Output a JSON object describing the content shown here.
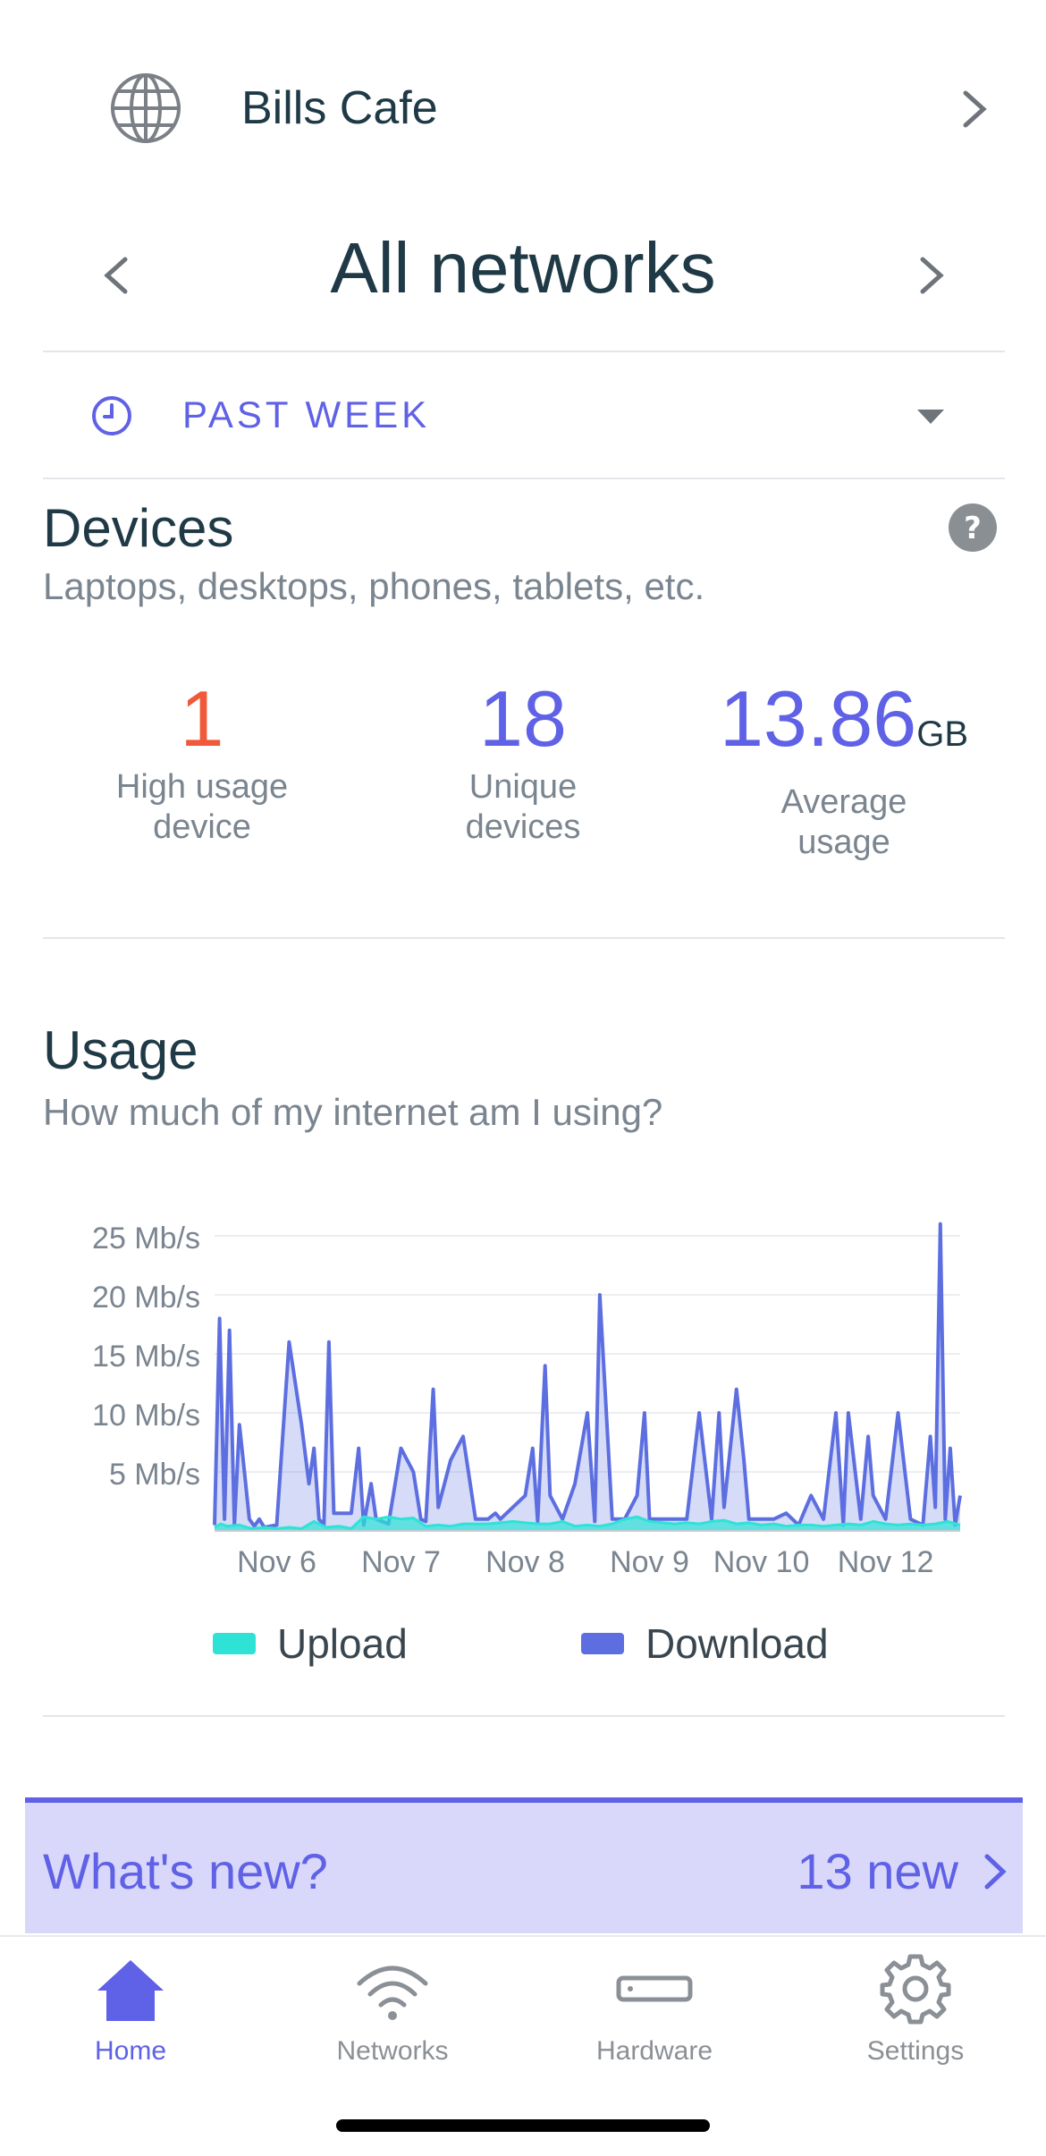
{
  "organization": {
    "name": "Bills Cafe"
  },
  "network_switcher": {
    "title": "All networks"
  },
  "time_filter": {
    "label": "PAST WEEK"
  },
  "devices": {
    "title": "Devices",
    "subtitle": "Laptops, desktops, phones, tablets, etc.",
    "stats": [
      {
        "value": "1",
        "unit": "",
        "label": "High usage device",
        "color": "#f05a3a"
      },
      {
        "value": "18",
        "unit": "",
        "label": "Unique devices",
        "color": "#5f61e6"
      },
      {
        "value": "13.86",
        "unit": "GB",
        "label": "Average usage",
        "color": "#5f61e6"
      }
    ]
  },
  "usage": {
    "title": "Usage",
    "subtitle": "How much of my internet am I using?"
  },
  "chart_data": {
    "type": "area",
    "y_ticks": [
      "25 Mb/s",
      "20 Mb/s",
      "15 Mb/s",
      "10 Mb/s",
      "5 Mb/s"
    ],
    "ylim": [
      0,
      25
    ],
    "x_ticks": [
      "Nov 6",
      "Nov 7",
      "Nov 8",
      "Nov 9",
      "Nov 10",
      "Nov 12"
    ],
    "x_tick_positions": [
      0.5,
      1.5,
      2.5,
      3.5,
      4.4,
      5.4
    ],
    "x_range": [
      0,
      6
    ],
    "grid": true,
    "legend": "bottom",
    "series": [
      {
        "name": "Upload",
        "color": "#2ee3d6",
        "x": [
          0,
          0.05,
          0.1,
          0.2,
          0.3,
          0.4,
          0.5,
          0.6,
          0.7,
          0.8,
          0.9,
          1.0,
          1.1,
          1.2,
          1.3,
          1.4,
          1.5,
          1.6,
          1.7,
          1.8,
          1.9,
          2.0,
          2.1,
          2.2,
          2.3,
          2.4,
          2.5,
          2.6,
          2.7,
          2.8,
          2.9,
          3.0,
          3.1,
          3.2,
          3.3,
          3.4,
          3.5,
          3.6,
          3.7,
          3.8,
          3.9,
          4.0,
          4.1,
          4.2,
          4.3,
          4.4,
          4.5,
          4.6,
          4.7,
          4.8,
          4.9,
          5.0,
          5.1,
          5.2,
          5.3,
          5.4,
          5.5,
          5.6,
          5.7,
          5.8,
          5.9,
          6.0
        ],
        "values": [
          0.3,
          0.6,
          0.4,
          0.5,
          0.2,
          0.3,
          0.2,
          0.3,
          0.2,
          0.8,
          0.3,
          0.4,
          0.2,
          1.2,
          1.0,
          1.2,
          1.0,
          1.1,
          0.4,
          0.5,
          0.4,
          0.6,
          0.6,
          0.6,
          0.7,
          0.8,
          0.7,
          0.6,
          0.6,
          0.8,
          0.4,
          0.5,
          0.4,
          0.6,
          1.0,
          1.2,
          0.8,
          0.7,
          0.6,
          0.7,
          0.6,
          0.8,
          0.9,
          0.6,
          0.7,
          0.5,
          0.6,
          0.4,
          0.5,
          0.5,
          0.4,
          0.5,
          0.6,
          0.5,
          0.8,
          0.6,
          0.5,
          0.6,
          0.5,
          0.6,
          0.8,
          0.5
        ]
      },
      {
        "name": "Download",
        "color": "#5d6fe0",
        "x": [
          0,
          0.04,
          0.08,
          0.12,
          0.16,
          0.2,
          0.24,
          0.28,
          0.32,
          0.36,
          0.4,
          0.5,
          0.6,
          0.7,
          0.76,
          0.8,
          0.84,
          0.88,
          0.92,
          0.96,
          1.0,
          1.1,
          1.16,
          1.2,
          1.26,
          1.3,
          1.4,
          1.5,
          1.6,
          1.66,
          1.7,
          1.76,
          1.8,
          1.9,
          2.0,
          2.1,
          2.2,
          2.26,
          2.3,
          2.4,
          2.5,
          2.56,
          2.6,
          2.66,
          2.7,
          2.8,
          2.9,
          3.0,
          3.06,
          3.1,
          3.2,
          3.26,
          3.3,
          3.4,
          3.46,
          3.5,
          3.6,
          3.7,
          3.8,
          3.9,
          4.0,
          4.06,
          4.1,
          4.2,
          4.26,
          4.3,
          4.4,
          4.5,
          4.6,
          4.7,
          4.8,
          4.9,
          5.0,
          5.06,
          5.1,
          5.2,
          5.26,
          5.3,
          5.4,
          5.5,
          5.6,
          5.7,
          5.76,
          5.8,
          5.84,
          5.88,
          5.92,
          5.96,
          6.0
        ],
        "values": [
          0.5,
          18,
          1,
          17,
          0.5,
          9,
          5,
          1,
          0.4,
          1,
          0.3,
          0.5,
          16,
          9,
          4,
          7,
          1,
          0.5,
          16,
          1.5,
          1.5,
          1.5,
          7,
          0.5,
          4,
          1,
          0.6,
          7,
          5,
          1,
          0.8,
          12,
          2,
          6,
          8,
          1,
          1,
          1.5,
          1,
          2,
          3,
          7,
          0.8,
          14,
          3,
          1,
          4,
          10,
          0.8,
          20,
          1,
          1,
          1,
          3,
          10,
          1,
          1,
          1,
          1,
          10,
          1,
          10,
          2,
          12,
          6,
          1,
          1,
          1,
          1.5,
          0.5,
          3,
          1,
          10,
          0.5,
          10,
          1,
          8,
          3,
          1,
          10,
          1,
          0.5,
          8,
          2,
          26,
          1,
          7,
          0.5,
          3
        ]
      }
    ]
  },
  "legend": {
    "upload_label": "Upload",
    "download_label": "Download"
  },
  "whats_new": {
    "title": "What's new?",
    "count_label": "13 new"
  },
  "tabbar": {
    "items": [
      {
        "label": "Home",
        "icon": "home-icon",
        "active": true
      },
      {
        "label": "Networks",
        "icon": "wifi-icon",
        "active": false
      },
      {
        "label": "Hardware",
        "icon": "hardware-icon",
        "active": false
      },
      {
        "label": "Settings",
        "icon": "gear-icon",
        "active": false
      }
    ]
  },
  "colors": {
    "accent": "#5f61e6",
    "alert": "#f05a3a",
    "text": "#1f3a46",
    "muted": "#7a8590"
  }
}
